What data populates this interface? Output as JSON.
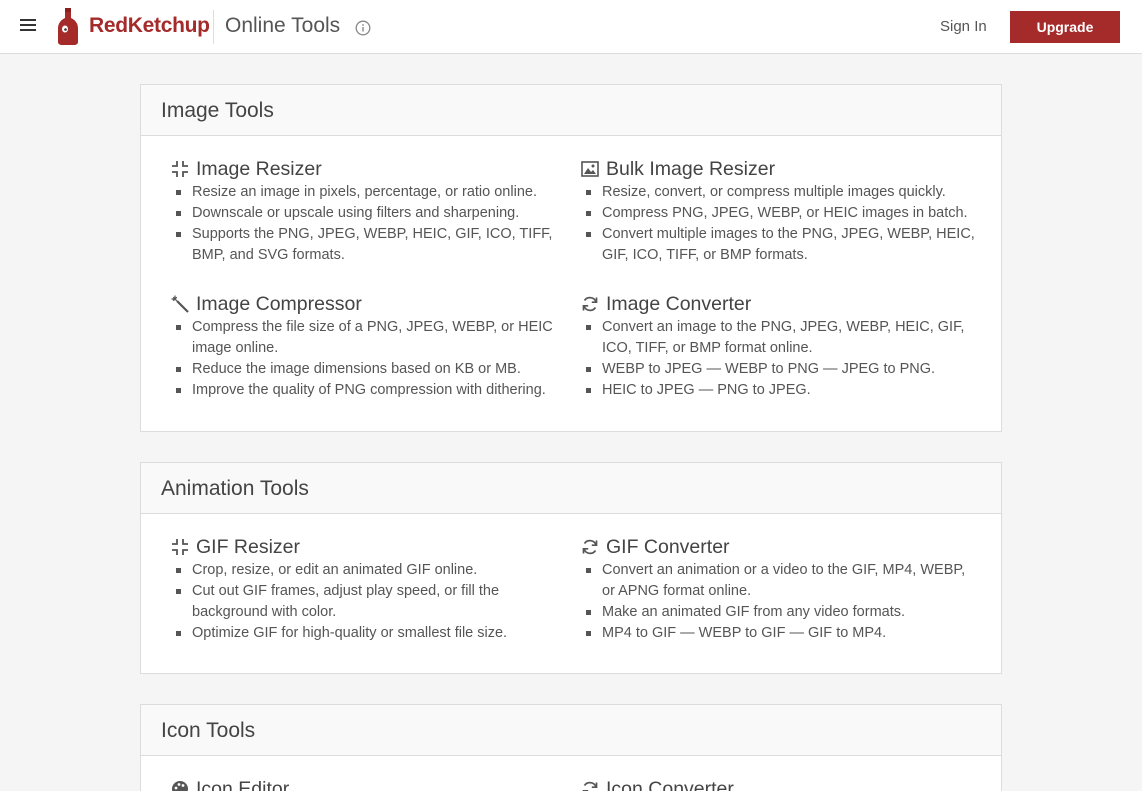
{
  "header": {
    "brand": "RedKetchup",
    "app_title": "Online Tools",
    "signin": "Sign In",
    "upgrade": "Upgrade"
  },
  "sections": [
    {
      "title": "Image Tools",
      "tools": [
        {
          "icon": "compress-arrows-icon",
          "title": "Image Resizer",
          "bullets": [
            "Resize an image in pixels, percentage, or ratio online.",
            "Downscale or upscale using filters and sharpening.",
            "Supports the PNG, JPEG, WEBP, HEIC, GIF, ICO, TIFF, BMP, and SVG formats."
          ]
        },
        {
          "icon": "image-icon",
          "title": "Bulk Image Resizer",
          "bullets": [
            "Resize, convert, or compress multiple images quickly.",
            "Compress PNG, JPEG, WEBP, or HEIC images in batch.",
            "Convert multiple images to the PNG, JPEG, WEBP, HEIC, GIF, ICO, TIFF, or BMP formats."
          ]
        },
        {
          "icon": "magic-wand-icon",
          "title": "Image Compressor",
          "bullets": [
            "Compress the file size of a PNG, JPEG, WEBP, or HEIC image online.",
            "Reduce the image dimensions based on KB or MB.",
            "Improve the quality of PNG compression with dithering."
          ]
        },
        {
          "icon": "refresh-icon",
          "title": "Image Converter",
          "bullets": [
            "Convert an image to the PNG, JPEG, WEBP, HEIC, GIF, ICO, TIFF, or BMP format online.",
            "WEBP to JPEG — WEBP to PNG — JPEG to PNG.",
            "HEIC to JPEG — PNG to JPEG."
          ]
        }
      ]
    },
    {
      "title": "Animation Tools",
      "tools": [
        {
          "icon": "compress-arrows-icon",
          "title": "GIF Resizer",
          "bullets": [
            "Crop, resize, or edit an animated GIF online.",
            "Cut out GIF frames, adjust play speed, or fill the background with color.",
            "Optimize GIF for high-quality or smallest file size."
          ]
        },
        {
          "icon": "refresh-icon",
          "title": "GIF Converter",
          "bullets": [
            "Convert an animation or a video to the GIF, MP4, WEBP, or APNG format online.",
            "Make an animated GIF from any video formats.",
            "MP4 to GIF — WEBP to GIF — GIF to MP4."
          ]
        }
      ]
    },
    {
      "title": "Icon Tools",
      "tools": [
        {
          "icon": "palette-icon",
          "title": "Icon Editor",
          "bullets": []
        },
        {
          "icon": "refresh-icon",
          "title": "Icon Converter",
          "bullets": []
        }
      ]
    }
  ]
}
